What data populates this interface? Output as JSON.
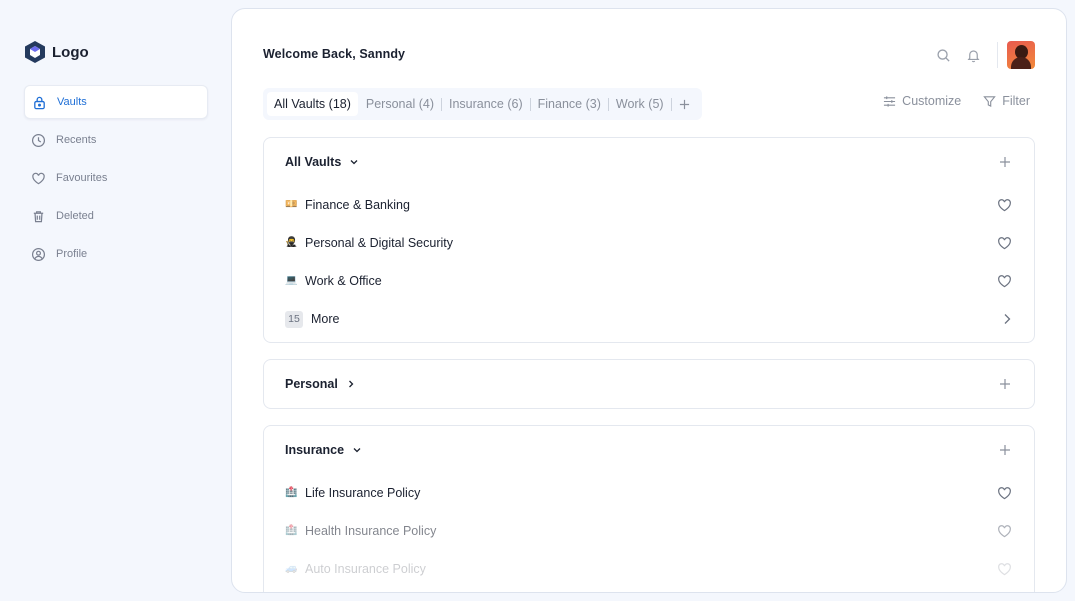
{
  "logo": {
    "text": "Logo"
  },
  "sidebar": {
    "items": [
      {
        "label": "Vaults",
        "icon": "lock-icon",
        "active": true
      },
      {
        "label": "Recents",
        "icon": "clock-icon",
        "active": false
      },
      {
        "label": "Favourites",
        "icon": "heart-icon",
        "active": false
      },
      {
        "label": "Deleted",
        "icon": "trash-icon",
        "active": false
      },
      {
        "label": "Profile",
        "icon": "user-circle-icon",
        "active": false
      }
    ]
  },
  "header": {
    "welcome": "Welcome Back, Sanndy",
    "icons": [
      "search-icon",
      "bell-icon"
    ],
    "avatar": "avatar"
  },
  "tabs": [
    {
      "label": "All Vaults (18)",
      "active": true
    },
    {
      "label": "Personal (4)"
    },
    {
      "label": "Insurance (6)"
    },
    {
      "label": "Finance (3)"
    },
    {
      "label": "Work (5)"
    }
  ],
  "actions": {
    "customize": "Customize",
    "filter": "Filter"
  },
  "sections": [
    {
      "title": "All Vaults",
      "expanded": true,
      "items": [
        {
          "label": "Finance & Banking",
          "emoji": "💴"
        },
        {
          "label": "Personal & Digital Security",
          "emoji": "🥷"
        },
        {
          "label": "Work & Office",
          "emoji": "💻"
        }
      ],
      "more": {
        "count": "15",
        "label": "More"
      }
    },
    {
      "title": "Personal",
      "expanded": false
    },
    {
      "title": "Insurance",
      "expanded": true,
      "items": [
        {
          "label": "Life Insurance Policy",
          "emoji": "🏥"
        },
        {
          "label": "Health Insurance Policy",
          "emoji": "🏥"
        },
        {
          "label": "Auto Insurance Policy",
          "emoji": "🚙"
        }
      ]
    }
  ],
  "colors": {
    "accent": "#1f6fd6",
    "background": "#f4f7fd",
    "text": "#1b2130",
    "muted": "#8a909c"
  }
}
